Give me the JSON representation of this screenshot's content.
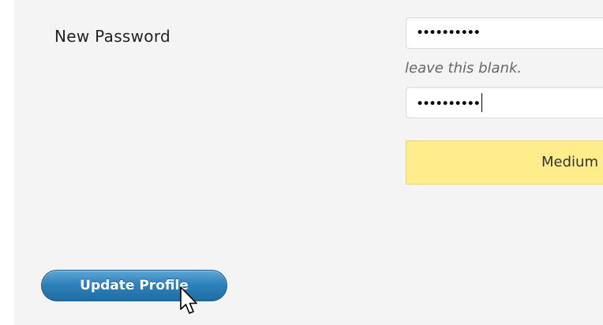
{
  "form": {
    "new_password_label": "New Password",
    "password_field_1_mask": "••••••••••",
    "hint_text": "leave this blank.",
    "password_field_2_mask": "••••••••••",
    "strength_text": "Medium",
    "update_button_label": "Update Profile"
  },
  "colors": {
    "panel_bg": "#f4f4f4",
    "strength_bg": "#ffec8b",
    "button_primary": "#2e82bb"
  },
  "icons": {
    "cursor": "mouse-pointer-icon"
  }
}
